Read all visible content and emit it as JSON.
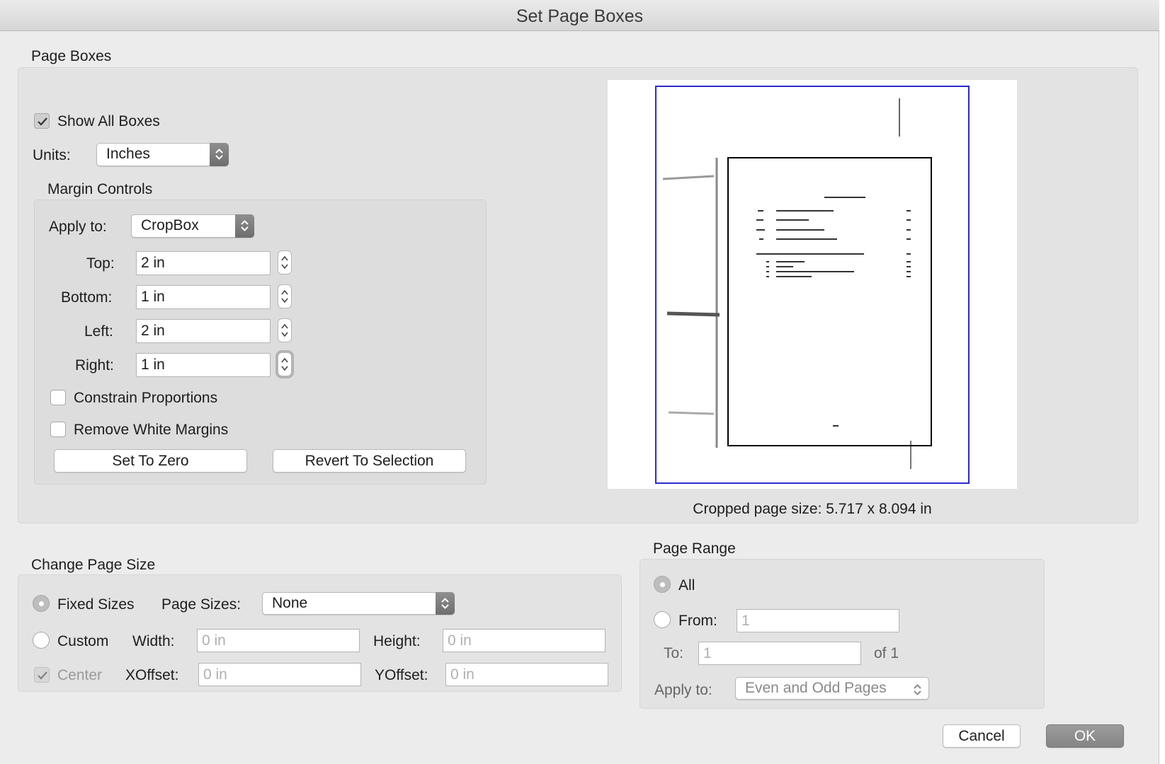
{
  "window": {
    "title": "Set Page Boxes"
  },
  "page_boxes": {
    "heading": "Page Boxes",
    "show_all_boxes": {
      "label": "Show All Boxes",
      "checked": true
    },
    "units": {
      "label": "Units:",
      "value": "Inches"
    },
    "margin_controls": {
      "heading": "Margin Controls",
      "apply_to": {
        "label": "Apply to:",
        "value": "CropBox"
      },
      "top": {
        "label": "Top:",
        "value": "2 in"
      },
      "bottom": {
        "label": "Bottom:",
        "value": "1 in"
      },
      "left": {
        "label": "Left:",
        "value": "2 in"
      },
      "right": {
        "label": "Right:",
        "value": "1 in"
      },
      "constrain_proportions": {
        "label": "Constrain Proportions",
        "checked": false
      },
      "remove_white_margins": {
        "label": "Remove White Margins",
        "checked": false
      },
      "set_to_zero": "Set To Zero",
      "revert_to_selection": "Revert To Selection"
    },
    "cropped_size": "Cropped page size: 5.717 x 8.094 in"
  },
  "change_page_size": {
    "heading": "Change Page Size",
    "fixed_sizes": {
      "label": "Fixed Sizes",
      "selected": true
    },
    "page_sizes": {
      "label": "Page Sizes:",
      "value": "None"
    },
    "custom": {
      "label": "Custom",
      "selected": false
    },
    "width": {
      "label": "Width:",
      "placeholder": "0 in"
    },
    "height": {
      "label": "Height:",
      "placeholder": "0 in"
    },
    "center": {
      "label": "Center",
      "checked": true
    },
    "xoffset": {
      "label": "XOffset:",
      "placeholder": "0 in"
    },
    "yoffset": {
      "label": "YOffset:",
      "placeholder": "0 in"
    }
  },
  "page_range": {
    "heading": "Page Range",
    "all": {
      "label": "All",
      "selected": true
    },
    "from": {
      "label": "From:",
      "placeholder": "1"
    },
    "to": {
      "label": "To:",
      "placeholder": "1"
    },
    "of_total": "of 1",
    "apply_to": {
      "label": "Apply to:",
      "value": "Even and Odd Pages"
    }
  },
  "footer": {
    "cancel": "Cancel",
    "ok": "OK"
  },
  "colors": {
    "media_box": "#2a2ad1",
    "crop_box": "#000000",
    "dialog_bg": "#ececec"
  }
}
